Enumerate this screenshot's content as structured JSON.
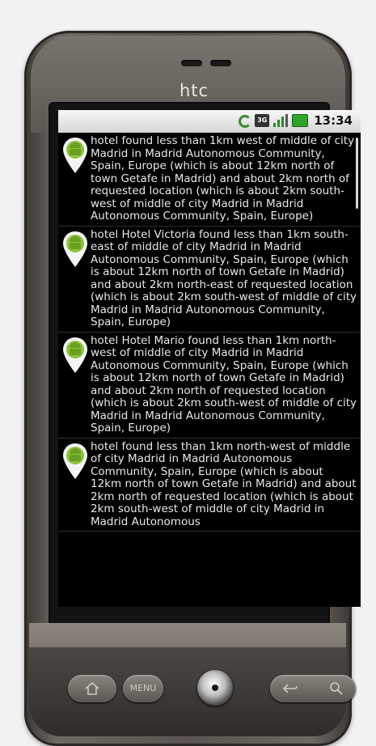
{
  "device": {
    "brand": "htc"
  },
  "statusbar": {
    "time": "13:34",
    "icons": [
      "sync-icon",
      "3g-icon",
      "signal-icon",
      "battery-icon"
    ],
    "network_label": "3G"
  },
  "results": [
    {
      "text": "hotel  found less than 1km west of middle of city Madrid in Madrid Autonomous Community, Spain, Europe (which is about 12km north of town Getafe in Madrid) and about 2km north of requested location (which is about 2km south-west of middle of city Madrid in Madrid Autonomous Community, Spain, Europe)"
    },
    {
      "text": "hotel Hotel Victoria found less than 1km south-east of middle of city Madrid in Madrid Autonomous Community, Spain, Europe (which is about 12km north of town Getafe in Madrid) and about 2km north-east of requested location  (which is about 2km south-west of middle of city Madrid in Madrid Autonomous Community, Spain, Europe)"
    },
    {
      "text": "hotel Hotel Mario found less than 1km north-west of middle of city Madrid in Madrid Autonomous Community, Spain, Europe (which is about 12km north of town Getafe in Madrid) and about 2km north of requested location  (which is about 2km south-west of middle of city Madrid in Madrid Autonomous Community, Spain, Europe)"
    },
    {
      "text": "hotel  found less than 1km north-west of middle of city Madrid in Madrid Autonomous Community, Spain, Europe (which is about 12km north of town Getafe in Madrid) and about 2km north of requested location (which is about 2km south-west of middle of city Madrid in Madrid Autonomous"
    }
  ],
  "hardware_buttons": {
    "menu_label": "MENU"
  },
  "colors": {
    "pin_green": "#8bc43a",
    "list_background": "#000000",
    "list_text": "#e8e8e8"
  }
}
